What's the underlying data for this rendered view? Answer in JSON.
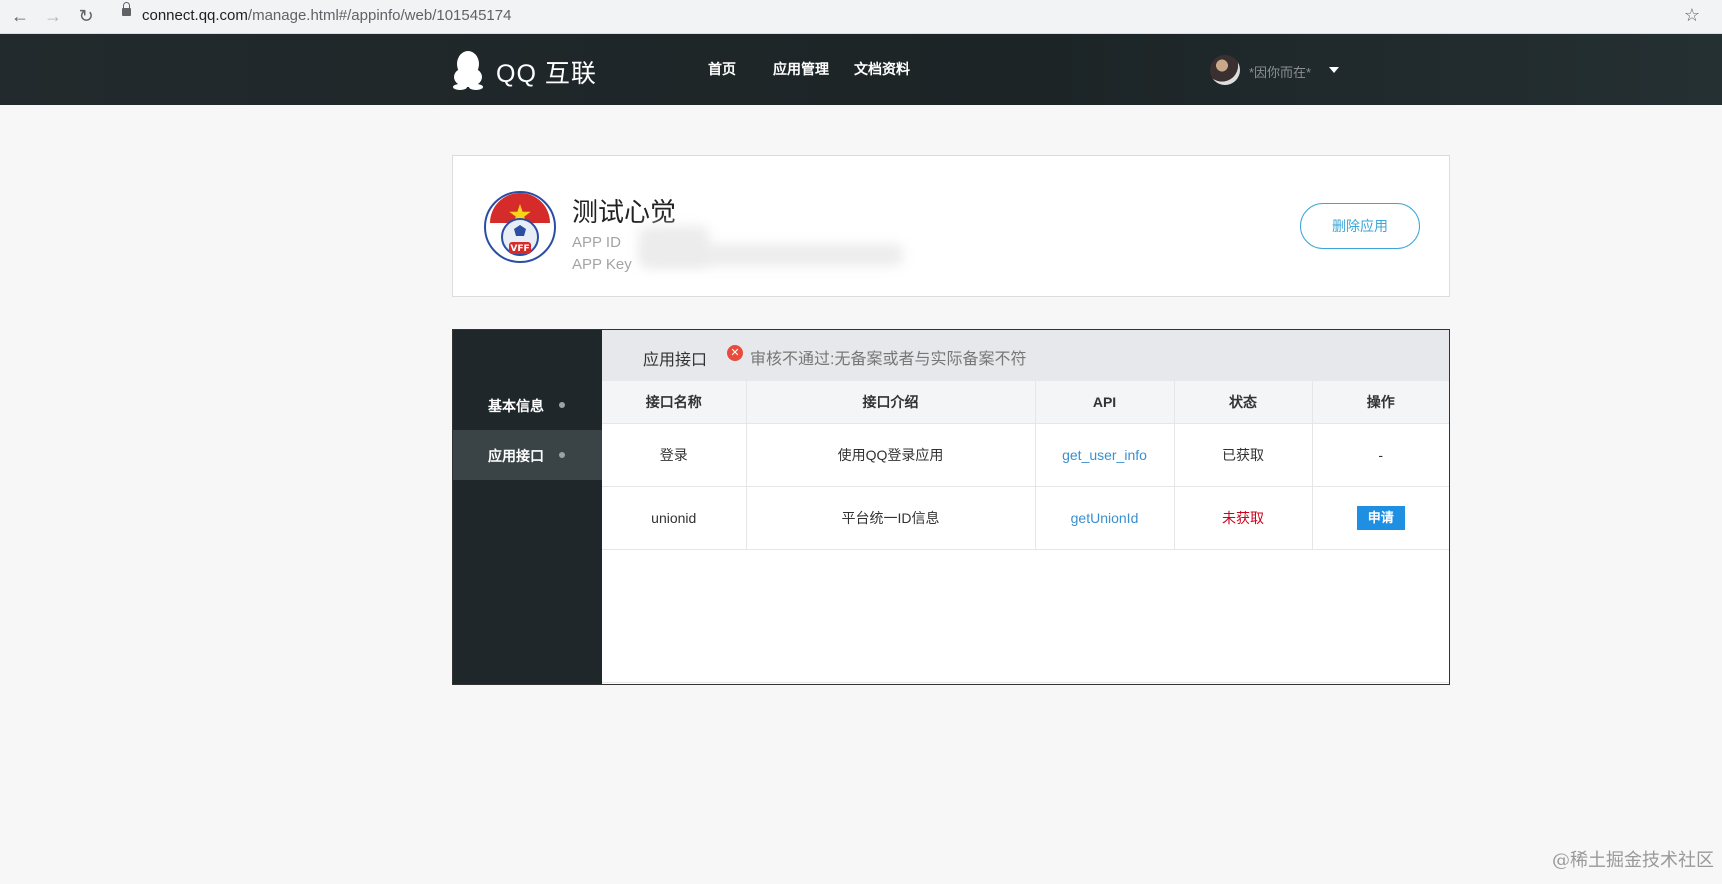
{
  "browser": {
    "url_host": "connect.qq.com",
    "url_path": "/manage.html#/appinfo/web/101545174"
  },
  "header": {
    "logo_text": "QQ 互联",
    "nav": [
      "首页",
      "应用管理",
      "文档资料"
    ],
    "username": "*因你而在*"
  },
  "app": {
    "name": "测试心觉",
    "app_id_label": "APP ID",
    "app_key_label": "APP Key",
    "delete_label": "删除应用",
    "logo_text": "VFF"
  },
  "sidebar": {
    "items": [
      {
        "label": "基本信息"
      },
      {
        "label": "应用接口"
      }
    ]
  },
  "content": {
    "title": "应用接口",
    "error_text": "审核不通过:无备案或者与实际备案不符",
    "columns": [
      "接口名称",
      "接口介绍",
      "API",
      "状态",
      "操作"
    ],
    "rows": [
      {
        "name": "登录",
        "desc": "使用QQ登录应用",
        "api": "get_user_info",
        "status": "已获取",
        "action": "-"
      },
      {
        "name": "unionid",
        "desc": "平台统一ID信息",
        "api": "getUnionId",
        "status": "未获取",
        "action": "申请"
      }
    ]
  },
  "watermark": "@稀土掘金技术社区"
}
